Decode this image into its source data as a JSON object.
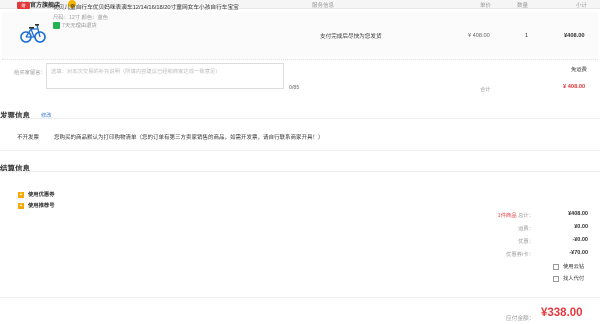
{
  "header": {
    "store_name": "优贝官方旗舰店",
    "col_service": "服务信息",
    "col_price": "单价",
    "col_qty": "数量",
    "col_subtotal": "小计"
  },
  "item": {
    "badge": "赠",
    "title": "优贝儿童自行车优贝妈咪表演车12/14/16/18/20寸童网女车小孩自行车宝宝",
    "attrs": "尺码：12寸    颜色：蓝色",
    "return_policy": "7天无理由退货",
    "shipping_service": "支付完成后尽快为您发货",
    "price": "¥ 408.00",
    "qty": "1",
    "subtotal": "¥408.00"
  },
  "message": {
    "label": "给买家留言：",
    "placeholder": "选填：对本次交易的补充说明（所填内容建议已经和商家达成一致意见）",
    "char_count": "0/85",
    "ship_method": "免运费",
    "total_label": "合计",
    "total_value": "¥ 408.00"
  },
  "invoice": {
    "title": "发票信息",
    "edit_link": "修改",
    "type": "不开发票",
    "note": "您购买的商品默认为打印购物清单（您的订单有第三方卖家销售的商品，如需开发票，请自行联系商家开具！）"
  },
  "settlement": {
    "title": "结算信息",
    "options": [
      "使用优惠券",
      "使用推荐号"
    ],
    "rows": [
      {
        "label_count": "1件商品",
        "label": "  总计：",
        "value": "¥408.00"
      },
      {
        "label_count": "",
        "label": "运费：",
        "value": "¥0.00"
      },
      {
        "label_count": "",
        "label": "优惠：",
        "value": "-¥0.00"
      },
      {
        "label_count": "",
        "label": "优惠券/卡：",
        "value": "-¥70.00"
      }
    ],
    "checkboxes": [
      "使用云钻",
      "找人代付"
    ]
  },
  "payment": {
    "label": "应付金额：",
    "value": "¥338.00"
  },
  "colors": {
    "accent_red": "#e4393c",
    "link_blue": "#3a78d8",
    "return_green": "#21b354",
    "plus_orange": "#f7a600"
  },
  "icons": [
    "store-logo-icon",
    "bicycle-product-image",
    "return-check-icon",
    "plus-icon",
    "checkbox-icon"
  ]
}
